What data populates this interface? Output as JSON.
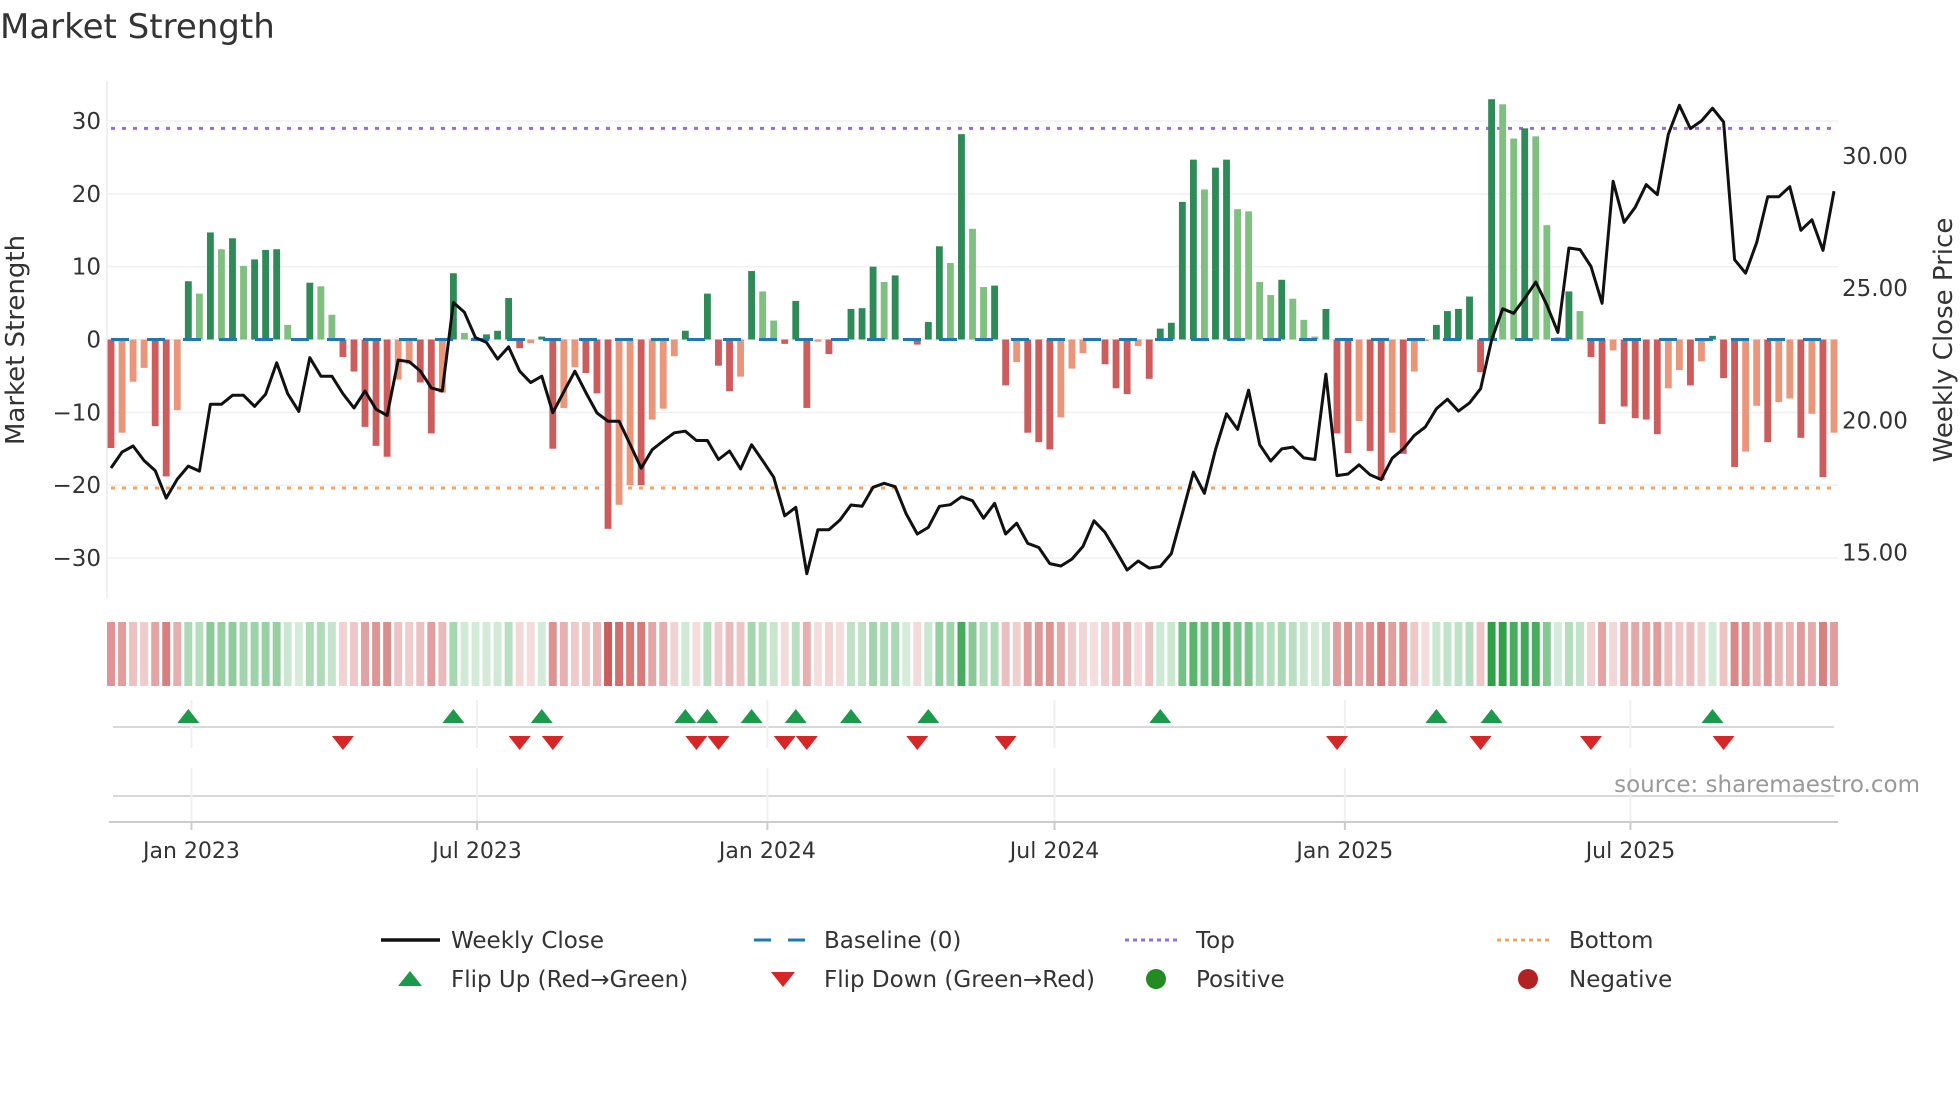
{
  "chart_data": {
    "type": "bar",
    "title": "Market Strength",
    "ylabel": "Market Strength",
    "y2label": "Weekly Close Price",
    "ylim": [
      -35.5,
      35.5
    ],
    "y2lim": [
      13.28,
      32.84
    ],
    "yticks": [
      30,
      20,
      10,
      0,
      -10,
      -20,
      -30
    ],
    "ytick_labels": [
      "30",
      "20",
      "10",
      "0",
      "−10",
      "−20",
      "−30"
    ],
    "y2ticks": [
      30,
      25,
      20,
      15
    ],
    "y2tick_labels": [
      "30.00",
      "25.00",
      "20.00",
      "15.00"
    ],
    "frequency": "weekly",
    "start_date": "2022-11-11",
    "xticks": [
      {
        "date": "2023-01-01",
        "label": "Jan 2023"
      },
      {
        "date": "2023-07-01",
        "label": "Jul 2023"
      },
      {
        "date": "2024-01-01",
        "label": "Jan 2024"
      },
      {
        "date": "2024-07-01",
        "label": "Jul 2024"
      },
      {
        "date": "2025-01-01",
        "label": "Jan 2025"
      },
      {
        "date": "2025-07-01",
        "label": "Jul 2025"
      }
    ],
    "top_level": 29.0,
    "bottom_level": -20.4,
    "baseline": 0,
    "grid": true,
    "legend_position": "bottom-center",
    "series": [
      {
        "name": "Market Strength",
        "type": "bar",
        "values": [
          -14.9,
          -12.8,
          -5.8,
          -3.9,
          -11.9,
          -18.8,
          -9.7,
          8.0,
          6.3,
          14.7,
          12.4,
          13.9,
          10.1,
          11.0,
          12.3,
          12.4,
          2.0,
          0.2,
          7.8,
          7.3,
          3.4,
          -2.4,
          -4.4,
          -12.0,
          -14.6,
          -16.1,
          -5.5,
          -3.4,
          -5.9,
          -12.9,
          -7.3,
          9.1,
          0.9,
          0.3,
          0.7,
          1.2,
          5.7,
          -1.2,
          -0.5,
          0.4,
          -15.0,
          -9.4,
          -3.8,
          -4.6,
          -7.4,
          -26.0,
          -22.7,
          -20.0,
          -20.0,
          -11.0,
          -9.5,
          -2.3,
          1.2,
          -0.2,
          6.3,
          -3.6,
          -7.1,
          -5.1,
          9.4,
          6.6,
          2.6,
          -0.6,
          5.3,
          -9.4,
          -0.3,
          -2.0,
          -0.2,
          4.2,
          4.3,
          10.0,
          7.9,
          8.8,
          0.2,
          -0.7,
          2.4,
          12.8,
          10.5,
          28.2,
          15.2,
          7.2,
          7.4,
          -6.3,
          -3.1,
          -12.8,
          -14.1,
          -15.1,
          -10.7,
          -4.0,
          -1.9,
          -0.2,
          -3.4,
          -6.7,
          -7.5,
          -0.9,
          -5.4,
          1.5,
          2.3,
          18.9,
          24.7,
          20.6,
          23.6,
          24.7,
          17.9,
          17.6,
          7.9,
          6.1,
          8.2,
          5.6,
          2.7,
          0.4,
          4.2,
          -12.9,
          -15.6,
          -11.2,
          -15.3,
          -19.3,
          -12.8,
          -15.7,
          -4.4,
          -0.2,
          2.0,
          3.9,
          4.2,
          5.9,
          -4.5,
          33.0,
          32.3,
          27.6,
          29.0,
          27.9,
          15.7,
          0.3,
          6.6,
          3.9,
          -2.4,
          -11.6,
          -1.5,
          -9.2,
          -10.8,
          -11.0,
          -13.0,
          -6.7,
          -4.2,
          -6.3,
          -3.0,
          0.5,
          -5.3,
          -17.5,
          -15.4,
          -9.1,
          -14.1,
          -8.6,
          -8.1,
          -13.5,
          -10.2,
          -18.9,
          -12.8
        ]
      },
      {
        "name": "Weekly Close",
        "type": "line",
        "axis": "right",
        "values": [
          18.2,
          18.8,
          19.03,
          18.48,
          18.1,
          17.06,
          17.78,
          18.27,
          18.08,
          20.61,
          20.61,
          20.95,
          20.95,
          20.53,
          20.99,
          22.18,
          21.01,
          20.34,
          22.37,
          21.67,
          21.67,
          21.01,
          20.47,
          21.11,
          20.42,
          20.19,
          22.28,
          22.22,
          21.87,
          21.23,
          21.11,
          24.46,
          24.09,
          23.13,
          22.95,
          22.32,
          22.78,
          21.86,
          21.43,
          21.67,
          20.29,
          21.08,
          21.86,
          21.05,
          20.28,
          19.97,
          19.97,
          19.09,
          18.19,
          18.89,
          19.22,
          19.53,
          19.59,
          19.24,
          19.24,
          18.52,
          18.84,
          18.16,
          19.08,
          18.48,
          17.85,
          16.39,
          16.71,
          14.2,
          15.86,
          15.86,
          16.23,
          16.8,
          16.75,
          17.47,
          17.62,
          17.49,
          16.46,
          15.7,
          15.95,
          16.75,
          16.81,
          17.11,
          16.96,
          16.3,
          16.86,
          15.7,
          16.11,
          15.35,
          15.19,
          14.58,
          14.49,
          14.75,
          15.23,
          16.2,
          15.76,
          15.06,
          14.34,
          14.68,
          14.41,
          14.47,
          14.96,
          16.49,
          18.04,
          17.24,
          18.89,
          20.25,
          19.66,
          21.14,
          19.08,
          18.46,
          18.92,
          18.99,
          18.58,
          18.52,
          21.75,
          17.91,
          17.97,
          18.32,
          17.94,
          17.76,
          18.57,
          18.92,
          19.43,
          19.75,
          20.44,
          20.8,
          20.35,
          20.66,
          21.2,
          23.04,
          24.22,
          24.05,
          24.62,
          25.23,
          24.37,
          23.33,
          26.52,
          26.46,
          25.82,
          24.43,
          29.05,
          27.49,
          28.06,
          28.92,
          28.54,
          30.82,
          31.92,
          31.04,
          31.33,
          31.81,
          31.29,
          26.08,
          25.57,
          26.73,
          28.46,
          28.46,
          28.84,
          27.19,
          27.59,
          26.43,
          28.67
        ]
      }
    ],
    "legend": [
      {
        "label": "Weekly Close",
        "marker": "line",
        "color": "#111111"
      },
      {
        "label": "Baseline (0)",
        "marker": "dash",
        "color": "#1f77b4"
      },
      {
        "label": "Top",
        "marker": "dot-line",
        "color": "#9b6bdc"
      },
      {
        "label": "Bottom",
        "marker": "dot-line",
        "color": "#f4a460"
      },
      {
        "label": "Flip Up (Red→Green)",
        "marker": "triangle-up",
        "color": "#1a9a4a"
      },
      {
        "label": "Flip Down (Green→Red)",
        "marker": "triangle-down",
        "color": "#d62728"
      },
      {
        "label": "Positive",
        "marker": "circle",
        "color": "#228b22"
      },
      {
        "label": "Negative",
        "marker": "circle",
        "color": "#b22222"
      }
    ],
    "source": "source: sharemaestro.com",
    "colors": {
      "pos_strong": "#2e8b57",
      "pos_weak": "#7fbf7f",
      "neg_strong": "#cd5c5c",
      "neg_weak": "#e9967a",
      "baseline": "#1f77b4",
      "top": "#9b6bdc",
      "bottom": "#f4a460",
      "flip_up": "#1a9a4a",
      "flip_down": "#d62728",
      "line": "#111111"
    }
  }
}
